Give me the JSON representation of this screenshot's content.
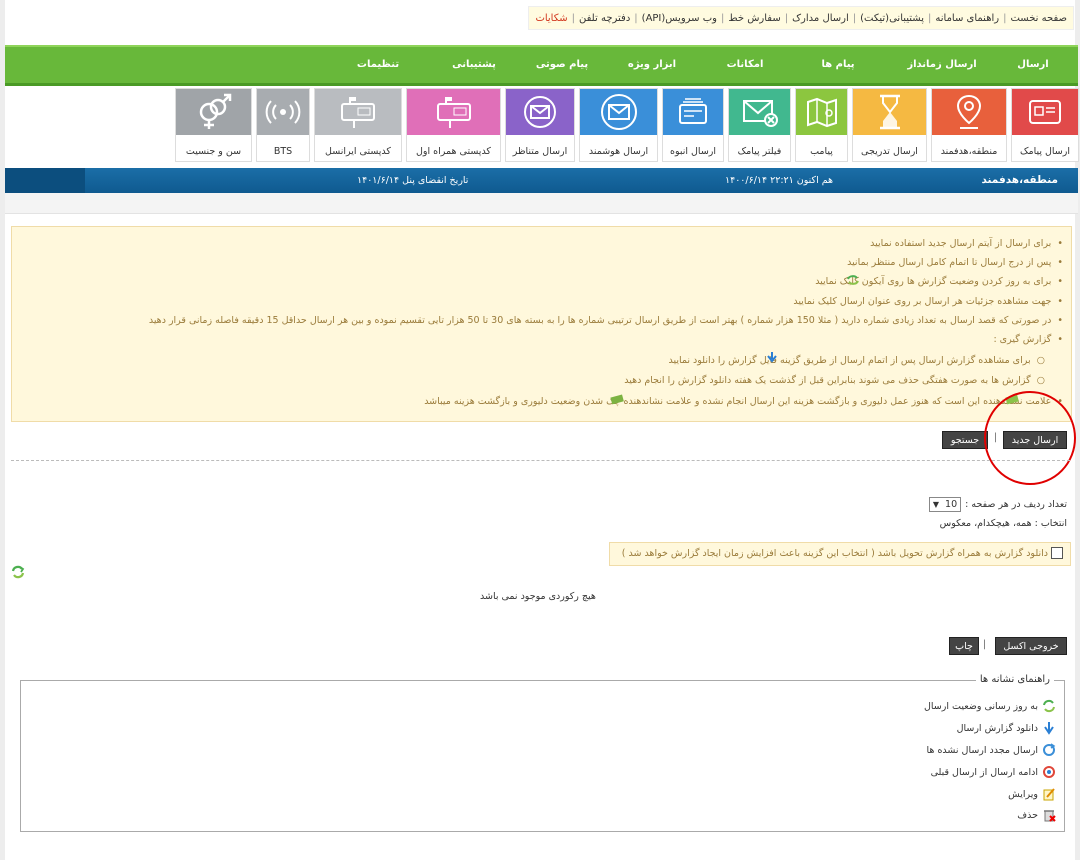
{
  "top_links": [
    "صفحه نخست",
    "راهنمای سامانه",
    "پشتیبانی(تیکت)",
    "ارسال مدارک",
    "سفارش خط",
    "وب سرویس(API)",
    "دفترچه تلفن",
    "شکایات"
  ],
  "nav": [
    "ارسال",
    "ارسال زمانداز",
    "پیام ها",
    "امکانات",
    "ابزار ویژه",
    "پیام صوتی",
    "پشتیبانی",
    "تنظیمات"
  ],
  "icons": [
    {
      "label": "ارسال پیامک",
      "icon": "sms-card-icon",
      "color": "#e14a4a"
    },
    {
      "label": "منطقه،هدفمند",
      "icon": "map-pin-icon",
      "color": "#e8603c"
    },
    {
      "label": "ارسال تدریجی",
      "icon": "hourglass-icon",
      "color": "#f5b942"
    },
    {
      "label": "پیامب",
      "icon": "map-icon",
      "color": "#8cc63f"
    },
    {
      "label": "فیلتر پیامک",
      "icon": "mail-x-icon",
      "color": "#41b88f"
    },
    {
      "label": "ارسال انبوه",
      "icon": "card-stack-icon",
      "color": "#3a8fd9"
    },
    {
      "label": "ارسال هوشمند",
      "icon": "smart-mail-icon",
      "color": "#3a8fd9"
    },
    {
      "label": "ارسال متناظر",
      "icon": "envelope-icon",
      "color": "#8a63c9"
    },
    {
      "label": "کدپستی همراه اول",
      "icon": "mailbox-ir-icon",
      "color": "#e06fb8"
    },
    {
      "label": "کدپستی ایرانسل",
      "icon": "mailbox-mtn-icon",
      "color": "#b9bcc0"
    },
    {
      "label": "BTS",
      "icon": "antenna-icon",
      "color": "#a8acb0"
    },
    {
      "label": "سن و جنسیت",
      "icon": "gender-icon",
      "color": "#a0a4a8"
    }
  ],
  "bar": {
    "title": "منطقه،هدفمند",
    "now": "هم اکنون ۲۲:۲۱ ۱۴۰۰/۶/۱۴",
    "expiry": "تاریخ انقضای پنل ۱۴۰۱/۶/۱۴"
  },
  "notices": [
    "برای ارسال از آیتم ارسال جدید استفاده نمایید",
    "پس از درج ارسال تا اتمام کامل ارسال منتظر بمانید",
    "برای به روز کردن وضعیت گزارش ها روی آیکون   کلیک نمایید",
    "جهت مشاهده جزئیات هر ارسال بر روی عنوان ارسال کلیک نمایید",
    "در صورتی که قصد ارسال به تعداد زیادی شماره دارید ( مثلا 150 هزار شماره ) بهتر است  از طریق ارسال ترتیبی شماره ها را به بسته های 30 تا 50 هزار تایی تقسیم نموده و بین هر ارسال حداقل 15 دقیقه فاصله زمانی قرار دهید",
    "گزارش گیری :",
    "برای مشاهده گزارش ارسال پس از اتمام ارسال از طریق گزینه   فایل گزارش را دانلود نمایید",
    "گزارش ها به صورت هفتگی حذف می شوند بنابراین قبل از گذشت یک هفته دانلود گزارش را انجام دهید",
    "علامت   نشاندهنده این است که هنوز عمل دلیوری و بازگشت هزینه این ارسال انجام نشده و علامت   نشاندهنده چک شدن وضعیت دلیوری و بازگشت هزینه میباشد"
  ],
  "buttons": {
    "new_send": "ارسال جدید",
    "search": "جستجو",
    "excel": "خروجی اکسل",
    "print": "چاپ",
    "sep": "|"
  },
  "rows_per_page": {
    "label": "تعداد ردیف در هر صفحه :",
    "value": "10"
  },
  "select_line": "انتخاب : همه، هیچکدام، معکوس",
  "download_checkbox": "دانلود گزارش به همراه گزارش تحویل باشد ( انتخاب این گزینه باعث افزایش زمان ایجاد گزارش خواهد شد )",
  "empty_message": "هیچ رکوردی موجود نمی باشد",
  "legend": {
    "title": "راهنمای نشانه ها",
    "items": [
      "به روز رسانی وضعیت ارسال",
      "دانلود گزارش ارسال",
      "ارسال مجدد ارسال نشده ها",
      "ادامه ارسال از ارسال قبلی",
      "ویرایش",
      "حذف"
    ]
  }
}
